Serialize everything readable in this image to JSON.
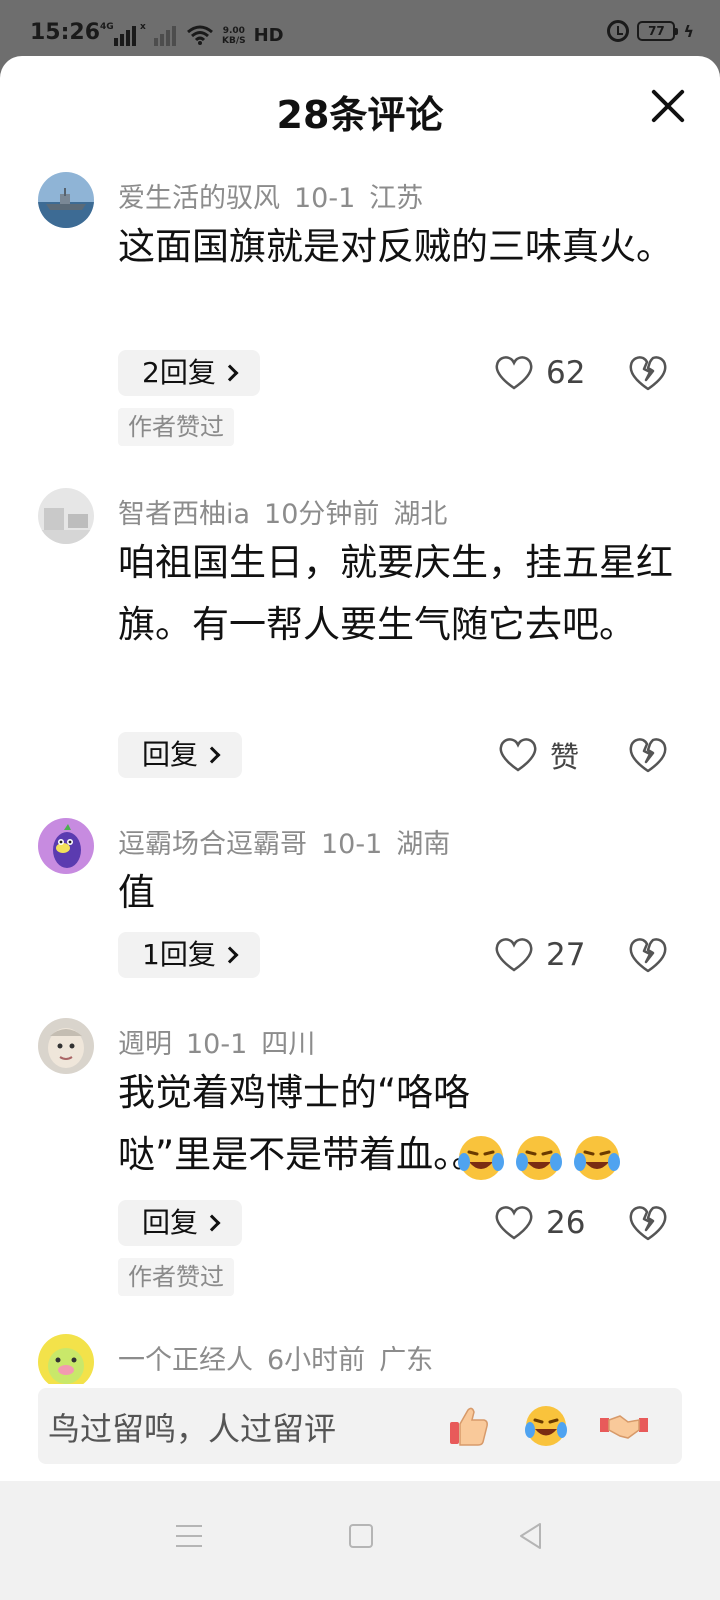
{
  "status_bar": {
    "time": "15:26",
    "signal1_label": "4G",
    "signal2_label": "x",
    "net_speed_value": "9.00",
    "net_speed_unit": "KB/S",
    "hd_label": "HD",
    "battery": "77"
  },
  "sheet": {
    "title": "28条评论"
  },
  "comments": [
    {
      "user": "爱生活的驭风",
      "time": "10-1",
      "location": "江苏",
      "text": "这面国旗就是对反贼的三味真火。",
      "reply_label": "2回复",
      "likes": "62",
      "author_liked": "作者赞过"
    },
    {
      "user": "智者西柚ia",
      "time": "10分钟前",
      "location": "湖北",
      "text": "咱祖国生日，就要庆生，挂五星红旗。有一帮人要生气随它去吧。",
      "reply_label": "回复",
      "likes": "赞"
    },
    {
      "user": "逗霸场合逗霸哥",
      "time": "10-1",
      "location": "湖南",
      "text": "值",
      "reply_label": "1回复",
      "likes": "27"
    },
    {
      "user": "週明",
      "time": "10-1",
      "location": "四川",
      "text": "我觉着鸡博士的“咯咯哒”里是不是带着血。。。",
      "reply_label": "回复",
      "likes": "26",
      "author_liked": "作者赞过"
    },
    {
      "user": "一个正经人",
      "time": "6小时前",
      "location": "广东"
    }
  ],
  "input": {
    "placeholder": "鸟过留鸣，人过留评"
  },
  "icons": [
    "close-icon",
    "heart-icon",
    "broken-heart-icon",
    "thumbs-up-emoji",
    "laughing-crying-emoji",
    "handshake-emoji",
    "menu-icon",
    "home-icon",
    "back-icon"
  ],
  "colors": {
    "text": "#111111",
    "meta": "#8c8c8c",
    "chip_bg": "#f2f2f2",
    "sheet_bg": "#ffffff",
    "status_bg": "#6e6e6e"
  }
}
